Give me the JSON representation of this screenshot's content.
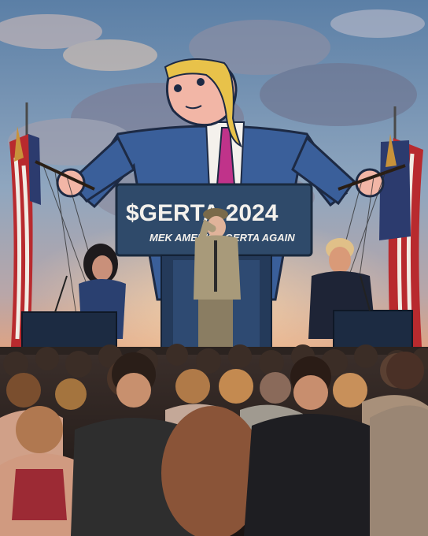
{
  "banner": {
    "title": "$GERTA 2024",
    "slogan": "MEK AMERICA GERTA AGAIN"
  },
  "colors": {
    "sky_top": "#5b7fa6",
    "sky_mid": "#9fb3c6",
    "sunset": "#e8a27a",
    "banner_bg": "#2f4a6a",
    "suit_blue": "#3a5f9a",
    "tie_magenta": "#c0338a",
    "creature_skin": "#f2b6a6",
    "hair_blonde": "#e8c24a",
    "podium": "#243a5a"
  }
}
